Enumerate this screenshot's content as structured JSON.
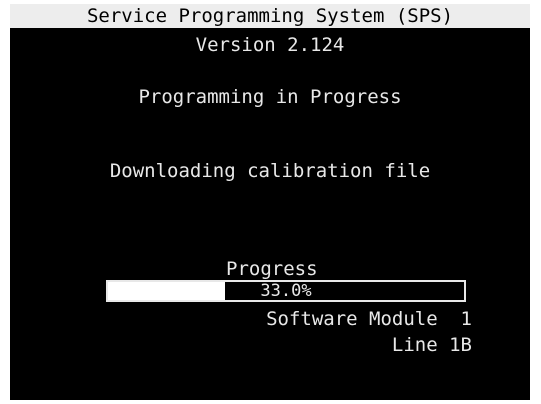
{
  "window": {
    "title": "Service Programming System (SPS)",
    "version": "Version 2.124"
  },
  "status": {
    "heading": "Programming in Progress",
    "task": "Downloading calibration file"
  },
  "progress": {
    "label": "Progress",
    "percent_text": "33.0%",
    "fraction": 0.33
  },
  "module": {
    "label": "Software Module  1",
    "line": "Line 1B"
  },
  "colors": {
    "background": "#000000",
    "text": "#e8e8e8",
    "title_bar": "#ededed",
    "progress_fill": "#ffffff"
  }
}
